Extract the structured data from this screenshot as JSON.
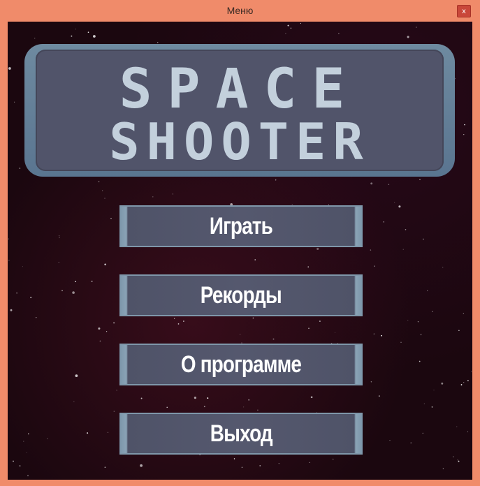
{
  "window": {
    "title": "Меню",
    "close_label": "x"
  },
  "logo": {
    "line1": "SPACE",
    "line2": "SHOOTER"
  },
  "menu": {
    "items": [
      {
        "label": "Играть"
      },
      {
        "label": "Рекорды"
      },
      {
        "label": "О программе"
      },
      {
        "label": "Выход"
      }
    ]
  },
  "colors": {
    "frame": "#f08b6a",
    "background": "#1b070f",
    "logo_text": "#c3d0dc",
    "button_face": "#55586e",
    "button_edge": "#7c96aa"
  }
}
